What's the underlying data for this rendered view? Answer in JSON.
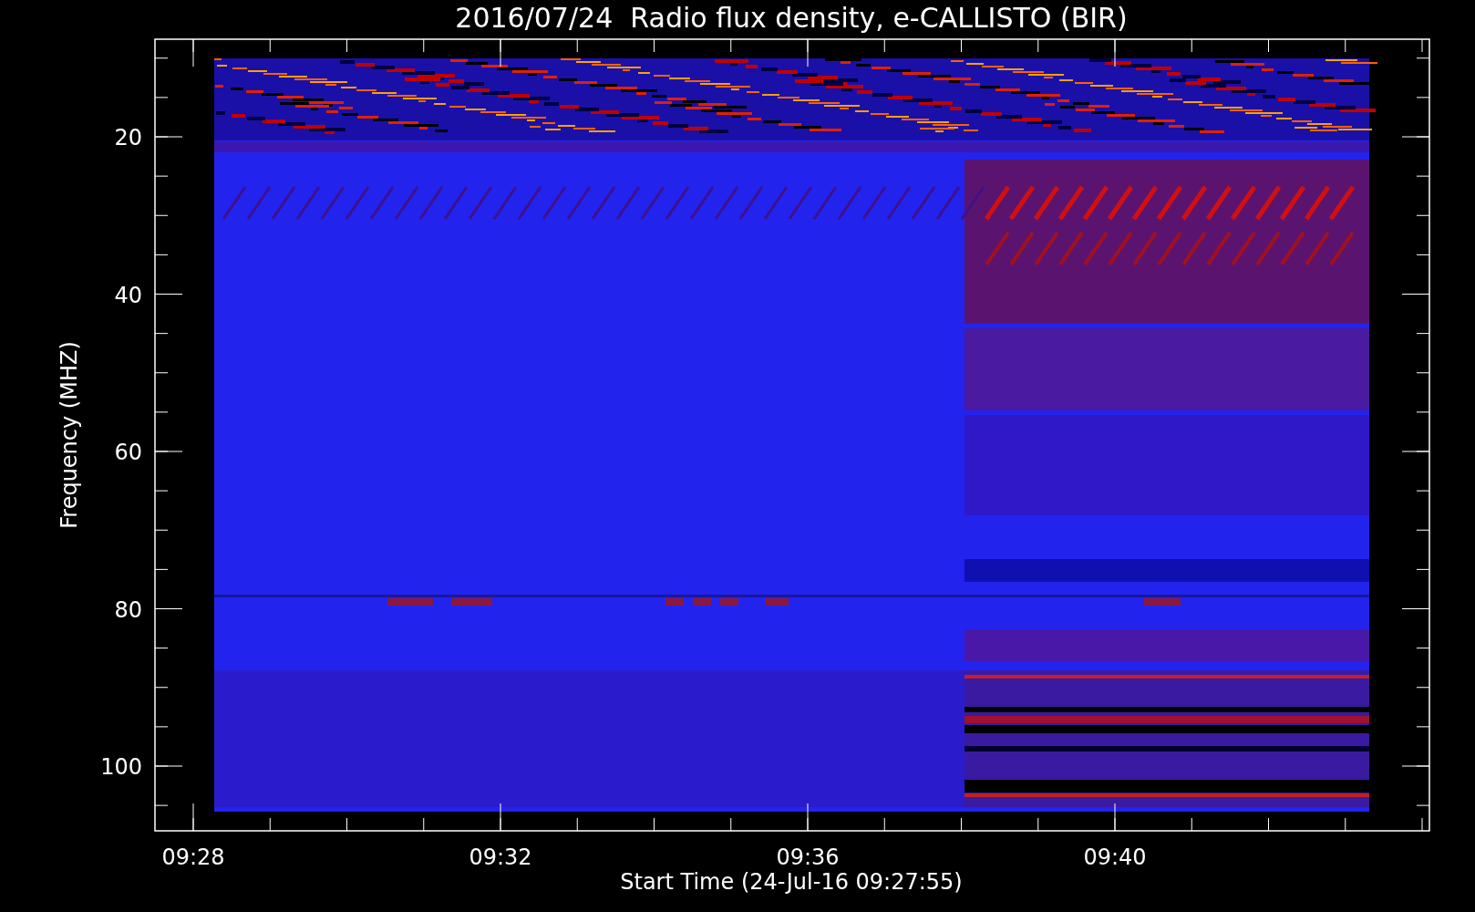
{
  "title": "2016/07/24  Radio flux density, e-CALLISTO (BIR)",
  "ylabel": "Frequency (MHZ)",
  "xlabel": "Start Time (24-Jul-16 09:27:55)",
  "yticks": [
    "20",
    "40",
    "60",
    "80",
    "100"
  ],
  "xticks": [
    "09:28",
    "09:32",
    "09:36",
    "09:40"
  ]
}
